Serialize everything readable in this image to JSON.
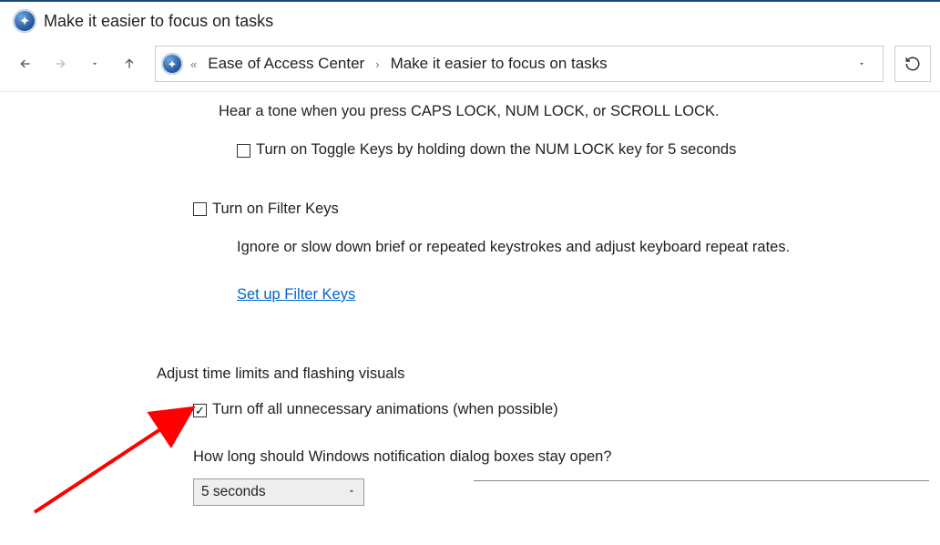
{
  "window": {
    "title": "Make it easier to focus on tasks"
  },
  "breadcrumb": {
    "item1": "Ease of Access Center",
    "item2": "Make it easier to focus on tasks"
  },
  "toggleKeys": {
    "desc": "Hear a tone when you press CAPS LOCK, NUM LOCK, or SCROLL LOCK.",
    "checkboxLabel": "Turn on Toggle Keys by holding down the NUM LOCK key for 5 seconds"
  },
  "filterKeys": {
    "checkboxLabel": "Turn on Filter Keys",
    "desc": "Ignore or slow down brief or repeated keystrokes and adjust keyboard repeat rates.",
    "link": "Set up Filter Keys"
  },
  "section": {
    "heading": "Adjust time limits and flashing visuals"
  },
  "animations": {
    "checkboxLabel": "Turn off all unnecessary animations (when possible)"
  },
  "notification": {
    "question": "How long should Windows notification dialog boxes stay open?",
    "selected": "5 seconds"
  }
}
